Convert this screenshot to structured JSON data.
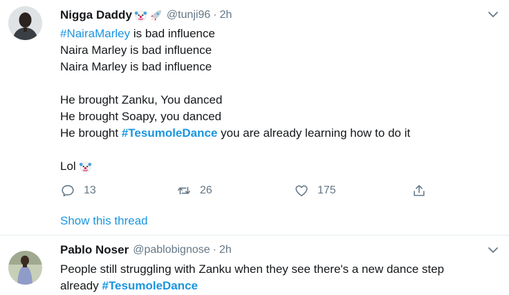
{
  "tweets": [
    {
      "display_name": "Nigga Daddy",
      "emojis": [
        "clown-face",
        "rocket"
      ],
      "handle": "@tunji96",
      "separator": "·",
      "time": "2h",
      "lines": [
        {
          "hashtag": "#NairaMarley",
          "text": " is bad influence"
        },
        {
          "text": "Naira Marley is bad influence"
        },
        {
          "text": "Naira Marley is bad influence"
        },
        {
          "text": ""
        },
        {
          "text": "He brought Zanku, You danced"
        },
        {
          "text": "He brought Soapy, you danced"
        },
        {
          "prefix": "He brought ",
          "hashtag": "#TesumoleDance",
          "suffix": " you are already learning how to do it"
        },
        {
          "text": ""
        },
        {
          "text": "Lol"
        }
      ],
      "actions": {
        "reply_count": "13",
        "retweet_count": "26",
        "like_count": "175"
      },
      "show_thread": "Show this thread"
    },
    {
      "display_name": "Pablo Noser",
      "handle": "@pablobignose",
      "separator": "·",
      "time": "2h",
      "line1": "People still struggling with Zanku when they see there's a new dance step",
      "line2_prefix": "already ",
      "line2_hashtag": "#TesumoleDance"
    }
  ],
  "colors": {
    "link": "#1b95e0",
    "muted": "#657786",
    "text": "#14171a",
    "divider": "#e6ecf0"
  },
  "icons": [
    "reply-icon",
    "retweet-icon",
    "like-icon",
    "share-icon",
    "chevron-down-icon"
  ]
}
